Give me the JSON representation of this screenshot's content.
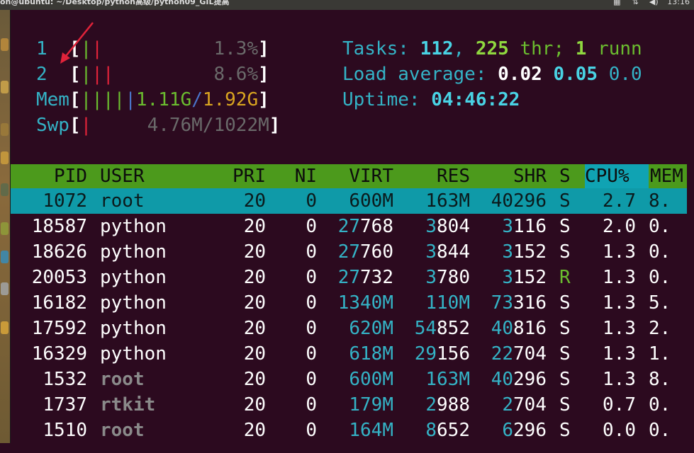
{
  "window": {
    "title": "on@ubuntu: ~/Desktop/python高级/python09_GIL提高",
    "clock": "13:16"
  },
  "meters": {
    "cpu1": {
      "label": "1",
      "bars": "||",
      "value": "1.3%"
    },
    "cpu2": {
      "label": "2",
      "bars": "|||",
      "value": "8.6%"
    },
    "mem": {
      "label": "Mem",
      "bars": "|||||",
      "used": "1.11G",
      "sep": "/",
      "total": "1.92G"
    },
    "swp": {
      "label": "Swp",
      "bars": "|",
      "value": "4.76M/1022M"
    }
  },
  "summary": {
    "tasks_label": "Tasks:",
    "tasks": "112",
    "thr": "225",
    "thr_label": "thr;",
    "running": "1",
    "running_label": "runn",
    "load_label": "Load average:",
    "load1": "0.02",
    "load5": "0.05",
    "load15": "0.0",
    "uptime_label": "Uptime:",
    "uptime": "04:46:22"
  },
  "table": {
    "columns": [
      "PID",
      "USER",
      "PRI",
      "NI",
      "VIRT",
      "RES",
      "SHR",
      "S",
      "CPU%",
      "MEM"
    ],
    "rows": [
      {
        "pid": "1072",
        "user": "root",
        "pri": "20",
        "ni": "0",
        "virt": "600M",
        "res": "163M",
        "shr": "40296",
        "s": "S",
        "cpu": "2.7",
        "mem": "8."
      },
      {
        "pid": "18587",
        "user": "python",
        "pri": "20",
        "ni": "0",
        "virt": "27768",
        "res": "3804",
        "shr": "3116",
        "s": "S",
        "cpu": "2.0",
        "mem": "0."
      },
      {
        "pid": "18626",
        "user": "python",
        "pri": "20",
        "ni": "0",
        "virt": "27760",
        "res": "3844",
        "shr": "3152",
        "s": "S",
        "cpu": "1.3",
        "mem": "0."
      },
      {
        "pid": "20053",
        "user": "python",
        "pri": "20",
        "ni": "0",
        "virt": "27732",
        "res": "3780",
        "shr": "3152",
        "s": "R",
        "cpu": "1.3",
        "mem": "0."
      },
      {
        "pid": "16182",
        "user": "python",
        "pri": "20",
        "ni": "0",
        "virt": "1340M",
        "res": "110M",
        "shr": "73316",
        "s": "S",
        "cpu": "1.3",
        "mem": "5."
      },
      {
        "pid": "17592",
        "user": "python",
        "pri": "20",
        "ni": "0",
        "virt": "620M",
        "res": "54852",
        "shr": "40816",
        "s": "S",
        "cpu": "1.3",
        "mem": "2."
      },
      {
        "pid": "16329",
        "user": "python",
        "pri": "20",
        "ni": "0",
        "virt": "618M",
        "res": "29156",
        "shr": "22704",
        "s": "S",
        "cpu": "1.3",
        "mem": "1."
      },
      {
        "pid": "1532",
        "user": "root",
        "pri": "20",
        "ni": "0",
        "virt": "600M",
        "res": "163M",
        "shr": "40296",
        "s": "S",
        "cpu": "1.3",
        "mem": "8."
      },
      {
        "pid": "1737",
        "user": "rtkit",
        "pri": "20",
        "ni": "0",
        "virt": "179M",
        "res": "2988",
        "shr": "2704",
        "s": "S",
        "cpu": "0.7",
        "mem": "0."
      },
      {
        "pid": "1510",
        "user": "root",
        "pri": "20",
        "ni": "0",
        "virt": "164M",
        "res": "8652",
        "shr": "6296",
        "s": "S",
        "cpu": "0.0",
        "mem": "0."
      }
    ]
  },
  "colors": {
    "background": "#2c0a1f",
    "header": "#4c9a1c",
    "selected_row": "#0f9aa8",
    "accent_cyan": "#34b3c6"
  }
}
